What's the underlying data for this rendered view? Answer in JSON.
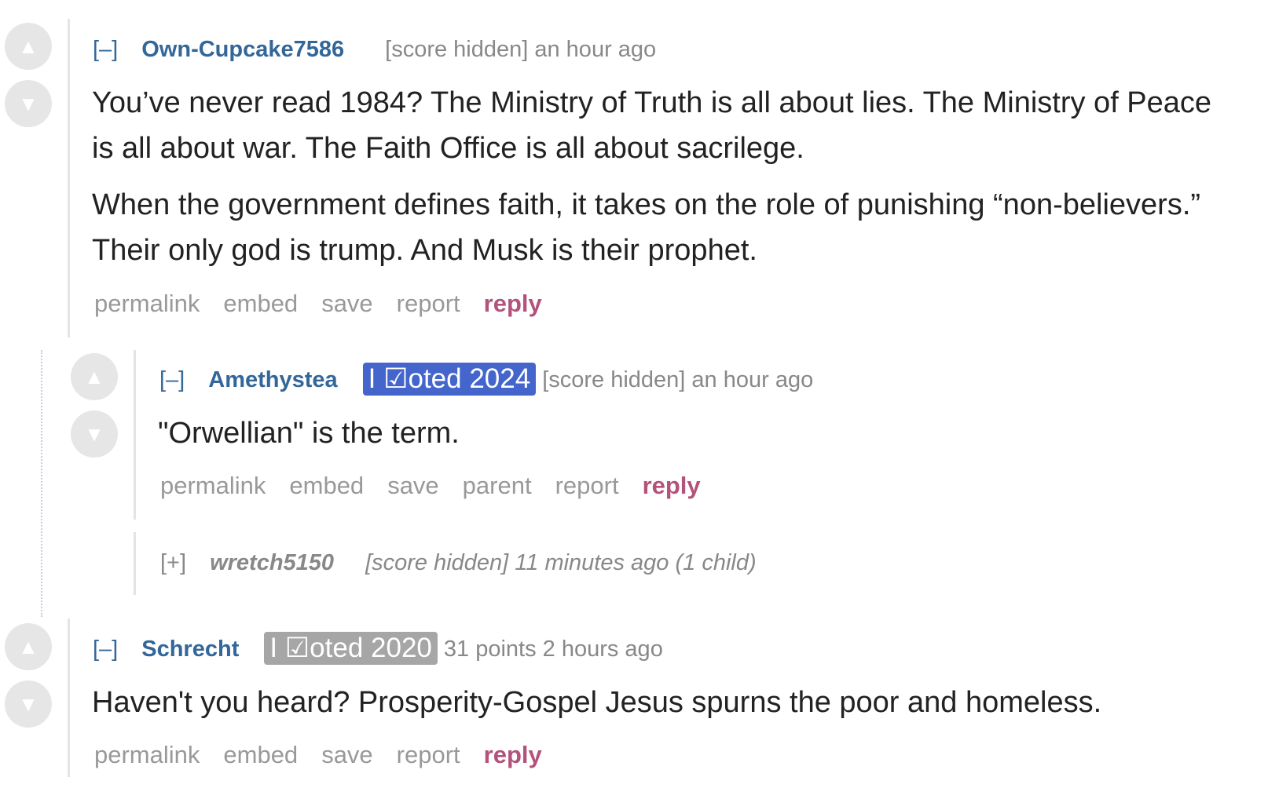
{
  "comments": [
    {
      "toggle": "[–]",
      "author": "Own-Cupcake7586",
      "meta": "[score hidden] an hour ago",
      "body": [
        "You’ve never read 1984? The Ministry of Truth is all about lies. The Ministry of Peace is all about war. The Faith Office is all about sacrilege.",
        "When the government defines faith, it takes on the role of punishing “non-believers.” Their only god is trump. And Musk is their prophet."
      ],
      "buttons": [
        "permalink",
        "embed",
        "save",
        "report",
        "reply"
      ]
    },
    {
      "toggle": "[–]",
      "author": "Amethystea",
      "flair": "I ☑oted 2024",
      "flair_color": "#4466cc",
      "meta": "[score hidden] an hour ago",
      "body": [
        "\"Orwellian\" is the term."
      ],
      "buttons": [
        "permalink",
        "embed",
        "save",
        "parent",
        "report",
        "reply"
      ]
    },
    {
      "toggle": "[+]",
      "author": "wretch5150",
      "meta": "[score hidden] 11 minutes ago (1 child)",
      "collapsed": true
    },
    {
      "toggle": "[–]",
      "author": "Schrecht",
      "flair": "I ☑oted 2020",
      "flair_color": "#a6a6a6",
      "meta": "31 points 2 hours ago",
      "body": [
        "Haven't you heard? Prosperity-Gospel Jesus spurns the poor and homeless."
      ],
      "buttons": [
        "permalink",
        "embed",
        "save",
        "report",
        "reply"
      ]
    }
  ],
  "icons": {
    "upvote": "▲",
    "downvote": "▼"
  },
  "colors": {
    "author": "#336699",
    "reply": "#b3527a",
    "muted": "#888888",
    "vote_circle": "#e6e6e6"
  }
}
